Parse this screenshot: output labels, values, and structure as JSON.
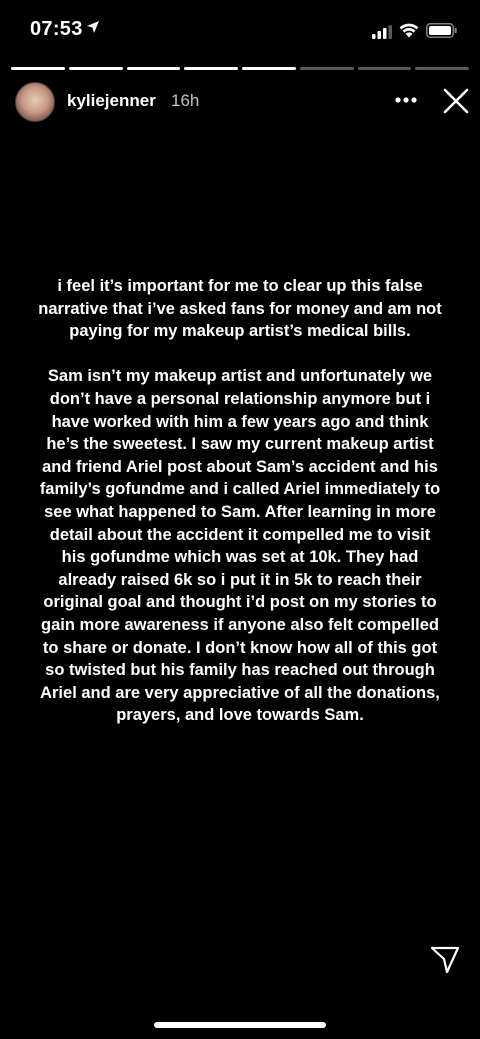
{
  "status_bar": {
    "time": "07:53",
    "icons": [
      "location-arrow-icon",
      "cellular-signal-icon",
      "wifi-icon",
      "battery-icon"
    ]
  },
  "story": {
    "segments_total": 8,
    "segments_viewed": 5,
    "username": "kyliejenner",
    "time_ago": "16h",
    "text": "i feel it’s important for me to clear up this false\nnarrative that i’ve asked fans for money and am not\npaying for my makeup artist’s medical bills.\n\nSam isn’t my makeup artist and unfortunately we\ndon’t have a personal relationship anymore but i\nhave worked with him a few years ago and think\nhe’s the sweetest. I saw my current makeup artist\nand friend Ariel post about Sam’s accident and his\nfamily’s gofundme and i called Ariel immediately to\nsee what happened to Sam. After learning in more\ndetail about the accident it compelled me to visit\nhis gofundme which was set at 10k. They had\nalready raised 6k so i put it in 5k to reach their\noriginal goal and thought i’d post on my stories to\ngain more awareness if anyone also felt compelled\nto share or donate. I don’t know how all of this got\nso twisted but his family has reached out through\nAriel and are very appreciative of all the donations,\nprayers, and love towards Sam."
  },
  "icons": {
    "more": "more-options-icon",
    "close": "close-icon",
    "send": "send-paper-plane-icon"
  },
  "colors": {
    "background": "#000000",
    "text": "#ffffff"
  }
}
